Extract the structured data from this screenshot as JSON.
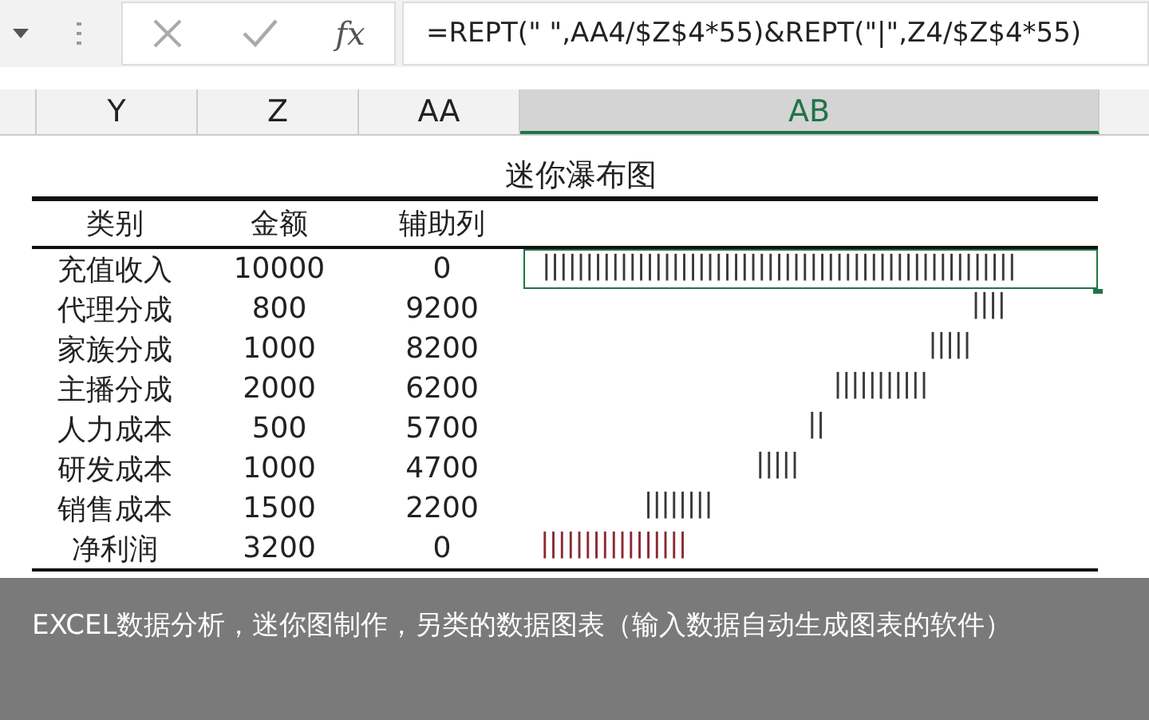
{
  "formula_bar": {
    "function_label": "fx",
    "formula": "=REPT(\" \",AA4/$Z$4*55)&REPT(\"|\",Z4/$Z$4*55)"
  },
  "column_headers": [
    {
      "label": "Y",
      "selected": false
    },
    {
      "label": "Z",
      "selected": false
    },
    {
      "label": "AA",
      "selected": false
    },
    {
      "label": "AB",
      "selected": true
    }
  ],
  "sheet": {
    "title": "迷你瀑布图",
    "headers": [
      "类别",
      "金额",
      "辅助列"
    ],
    "rows": [
      {
        "category": "充值收入",
        "amount": "10000",
        "helper": "0",
        "bar": "|||||||||||||||||||||||||||||||||||||||||||||||||||||||",
        "color": "#3a3a3a",
        "selected": true
      },
      {
        "category": "代理分成",
        "amount": "800",
        "helper": "9200",
        "bar": "                                                  ||||",
        "color": "#3a3a3a",
        "selected": false
      },
      {
        "category": "家族分成",
        "amount": "1000",
        "helper": "8200",
        "bar": "                                             |||||",
        "color": "#3a3a3a",
        "selected": false
      },
      {
        "category": "主播分成",
        "amount": "2000",
        "helper": "6200",
        "bar": "                                  |||||||||||",
        "color": "#3a3a3a",
        "selected": false
      },
      {
        "category": "人力成本",
        "amount": "500",
        "helper": "5700",
        "bar": "                               ||",
        "color": "#3a3a3a",
        "selected": false
      },
      {
        "category": "研发成本",
        "amount": "1000",
        "helper": "4700",
        "bar": "                         |||||",
        "color": "#3a3a3a",
        "selected": false
      },
      {
        "category": "销售成本",
        "amount": "1500",
        "helper": "2200",
        "bar": "            ||||||||",
        "color": "#3a3a3a",
        "selected": false
      },
      {
        "category": "净利润",
        "amount": "3200",
        "helper": "0",
        "bar": "|||||||||||||||||",
        "color": "#8b2a35",
        "selected": false
      }
    ]
  },
  "caption": "EXCEL数据分析，迷你图制作，另类的数据图表（输入数据自动生成图表的软件）"
}
